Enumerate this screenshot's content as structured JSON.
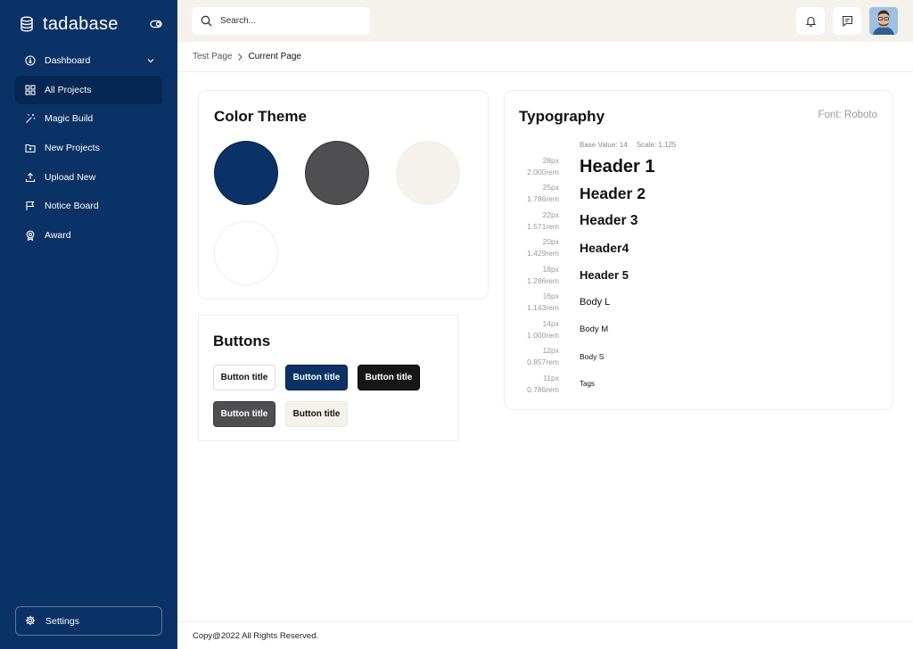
{
  "app": {
    "name": "tadabase"
  },
  "sidebar": {
    "items": [
      {
        "label": "Dashboard",
        "icon": "dashboard-icon",
        "active": false,
        "has_chevron": true
      },
      {
        "label": "All Projects",
        "icon": "grid-icon",
        "active": true
      },
      {
        "label": "Magic Build",
        "icon": "magic-wand-icon",
        "active": false
      },
      {
        "label": "New Projects",
        "icon": "folder-plus-icon",
        "active": false
      },
      {
        "label": "Upload New",
        "icon": "upload-icon",
        "active": false
      },
      {
        "label": "Notice Board",
        "icon": "flag-icon",
        "active": false
      },
      {
        "label": "Award",
        "icon": "award-icon",
        "active": false
      }
    ],
    "settings_label": "Settings"
  },
  "topbar": {
    "search_placeholder": "Search...",
    "icons": [
      "bell-icon",
      "message-icon"
    ]
  },
  "breadcrumb": {
    "parent": "Test Page",
    "current": "Current Page"
  },
  "color_theme": {
    "title": "Color Theme",
    "swatches": [
      "#0b3266",
      "#4f4f51",
      "#f4f2ea",
      "#ffffff"
    ]
  },
  "buttons": {
    "title": "Buttons",
    "items": [
      {
        "label": "Button title",
        "style": "outline-white"
      },
      {
        "label": "Button title",
        "style": "primary-navy"
      },
      {
        "label": "Button title",
        "style": "black"
      },
      {
        "label": "Button title",
        "style": "gray"
      },
      {
        "label": "Button title",
        "style": "cream"
      }
    ]
  },
  "typography": {
    "title": "Typography",
    "font_label": "Font: Roboto",
    "base_value": "Base Value: 14",
    "scale": "Scale: 1.125",
    "rows": [
      {
        "px": "28px",
        "rem": "2.000rem",
        "sample": "Header 1"
      },
      {
        "px": "25px",
        "rem": "1.786rem",
        "sample": "Header 2"
      },
      {
        "px": "22px",
        "rem": "1.571rem",
        "sample": "Header 3"
      },
      {
        "px": "20px",
        "rem": "1.429rem",
        "sample": "Header4"
      },
      {
        "px": "18px",
        "rem": "1.286rem",
        "sample": "Header 5"
      },
      {
        "px": "16px",
        "rem": "1.143rem",
        "sample": "Body L"
      },
      {
        "px": "14px",
        "rem": "1.000rem",
        "sample": "Body M"
      },
      {
        "px": "12px",
        "rem": "0.857rem",
        "sample": "Body S"
      },
      {
        "px": "11px",
        "rem": "0.786rem",
        "sample": "Tags"
      }
    ]
  },
  "footer": {
    "text": "Copy@2022 All Rights Reserved."
  }
}
